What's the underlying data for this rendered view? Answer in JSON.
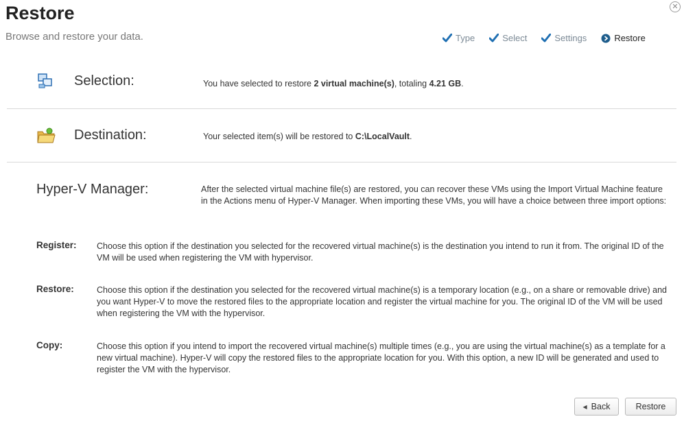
{
  "header": {
    "title": "Restore",
    "subtitle": "Browse and restore your data.",
    "close_icon": "close-icon"
  },
  "steps": [
    {
      "label": "Type",
      "state": "done"
    },
    {
      "label": "Select",
      "state": "done"
    },
    {
      "label": "Settings",
      "state": "done"
    },
    {
      "label": "Restore",
      "state": "current"
    }
  ],
  "selection": {
    "label": "Selection:",
    "text_prefix": "You have selected to restore ",
    "text_count": "2 virtual machine(s)",
    "text_middle": ", totaling ",
    "text_size": "4.21 GB",
    "text_suffix": "."
  },
  "destination": {
    "label": "Destination:",
    "text_prefix": "Your selected item(s) will be restored to ",
    "text_path": "C:\\LocalVault",
    "text_suffix": "."
  },
  "hyperv": {
    "label": "Hyper-V Manager:",
    "text": "After the selected virtual machine file(s) are restored, you can recover these VMs using the Import Virtual Machine feature in the Actions menu of Hyper-V Manager. When importing these VMs, you will have a choice between three import options:"
  },
  "options": [
    {
      "label": "Register:",
      "text": "Choose this option if the destination you selected for the recovered virtual machine(s) is the destination you intend to run it from.  The original ID of the VM will be used when registering the VM with hypervisor."
    },
    {
      "label": "Restore:",
      "text": "Choose this option if the destination you selected for the recovered virtual machine(s) is a temporary location (e.g., on a share or removable drive) and you want Hyper-V to move the restored files to the appropriate location and register the virtual machine for you.  The original ID of the VM will be used when registering the VM with the hypervisor."
    },
    {
      "label": "Copy:",
      "text": "Choose this option if you intend to import the recovered virtual machine(s) multiple times (e.g., you are using the virtual machine(s) as a template for a new virtual machine).  Hyper-V will copy the restored files to the appropriate location for you.  With this option, a new ID will be generated and used to register the VM with the hypervisor."
    }
  ],
  "buttons": {
    "back": "Back",
    "restore": "Restore"
  },
  "colors": {
    "check": "#1f6fb2",
    "current_step": "#1e5d8c"
  }
}
